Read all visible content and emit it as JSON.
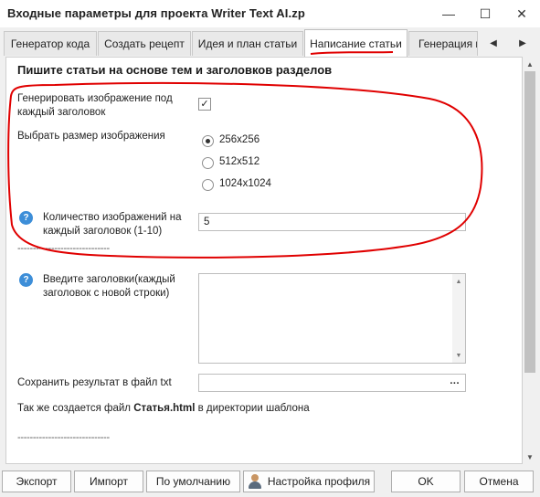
{
  "window": {
    "title": "Входные параметры для проекта Writer Text AI.zp",
    "minimize_glyph": "—",
    "maximize_glyph": "☐",
    "close_glyph": "✕"
  },
  "tabs": [
    {
      "label": "Генератор кода"
    },
    {
      "label": "Создать рецепт"
    },
    {
      "label": "Идея и план статьи"
    },
    {
      "label": "Написание статьи"
    },
    {
      "label": "Генерация и"
    }
  ],
  "tab_nav": {
    "prev": "◀",
    "next": "▶"
  },
  "section": {
    "heading": "Пишите статьи на основе тем и заголовков разделов",
    "generate_image": {
      "label": "Генерировать изображение под каждый заголовок",
      "checked_glyph": "✓"
    },
    "image_size": {
      "label": "Выбрать размер изображения",
      "options": [
        {
          "label": "256x256",
          "selected": true
        },
        {
          "label": "512x512",
          "selected": false
        },
        {
          "label": "1024x1024",
          "selected": false
        }
      ]
    },
    "images_count": {
      "label": "Количество изображений на каждый заголовок (1-10)",
      "value": "5"
    },
    "divider_1": "------------------------------",
    "headings": {
      "label": "Введите заголовки(каждый заголовок с новой строки)",
      "value": ""
    },
    "save_result": {
      "label": "Сохранить результат в файл txt",
      "value": "",
      "browse_label": "..."
    },
    "note_prefix": "Так же создается файл ",
    "note_bold": "Статья.html",
    "note_suffix": " в директории шаблона",
    "divider_2": "------------------------------"
  },
  "help_icon_glyph": "?",
  "footer": {
    "export": "Экспорт",
    "import": "Импорт",
    "defaults": "По умолчанию",
    "profile_settings": "Настройка профиля",
    "ok": "OK",
    "cancel": "Отмена"
  },
  "colors": {
    "annotation": "#e00000",
    "active_tab_underline": "#e00000",
    "help_icon": "#3d8ed8"
  }
}
